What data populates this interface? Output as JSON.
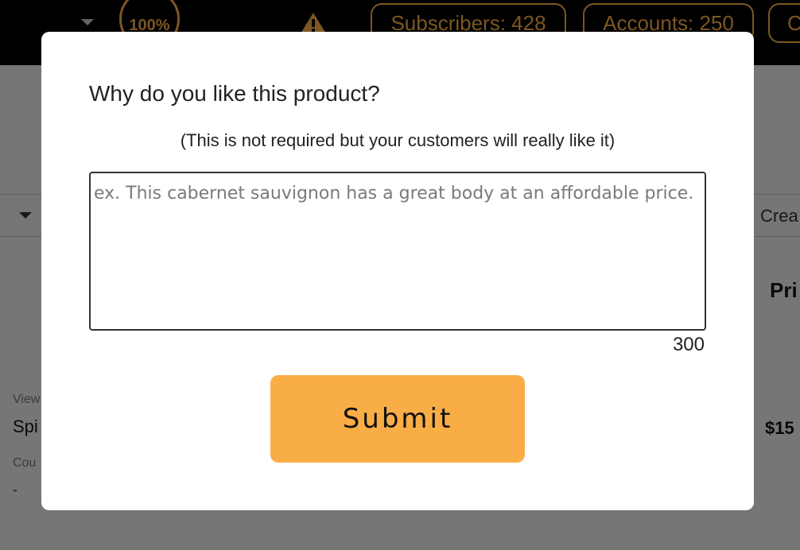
{
  "topbar": {
    "zoom_label": "100%",
    "warning_icon": "warning-triangle-icon",
    "subscribers_label": "Subscribers: 428",
    "accounts_label": "Accounts: 250",
    "extra_pill_label": "C"
  },
  "filterbar": {
    "create_label": "Crea"
  },
  "background_list": {
    "price_header": "Pri",
    "view_label": "View",
    "product_name": "Spi",
    "price_value": "$15",
    "count_label": "Cou",
    "count_value": "-"
  },
  "modal": {
    "title": "Why do you like this product?",
    "subtitle": "(This is not required but your customers will really like it)",
    "input_placeholder": "ex. This cabernet sauvignon has a great body at an affordable price.",
    "input_value": "",
    "char_counter": "300",
    "submit_label": "Submit"
  },
  "colors": {
    "accent": "#f9ad47",
    "overlay": "rgba(0,0,0,0.5)",
    "topbar": "#000000"
  }
}
